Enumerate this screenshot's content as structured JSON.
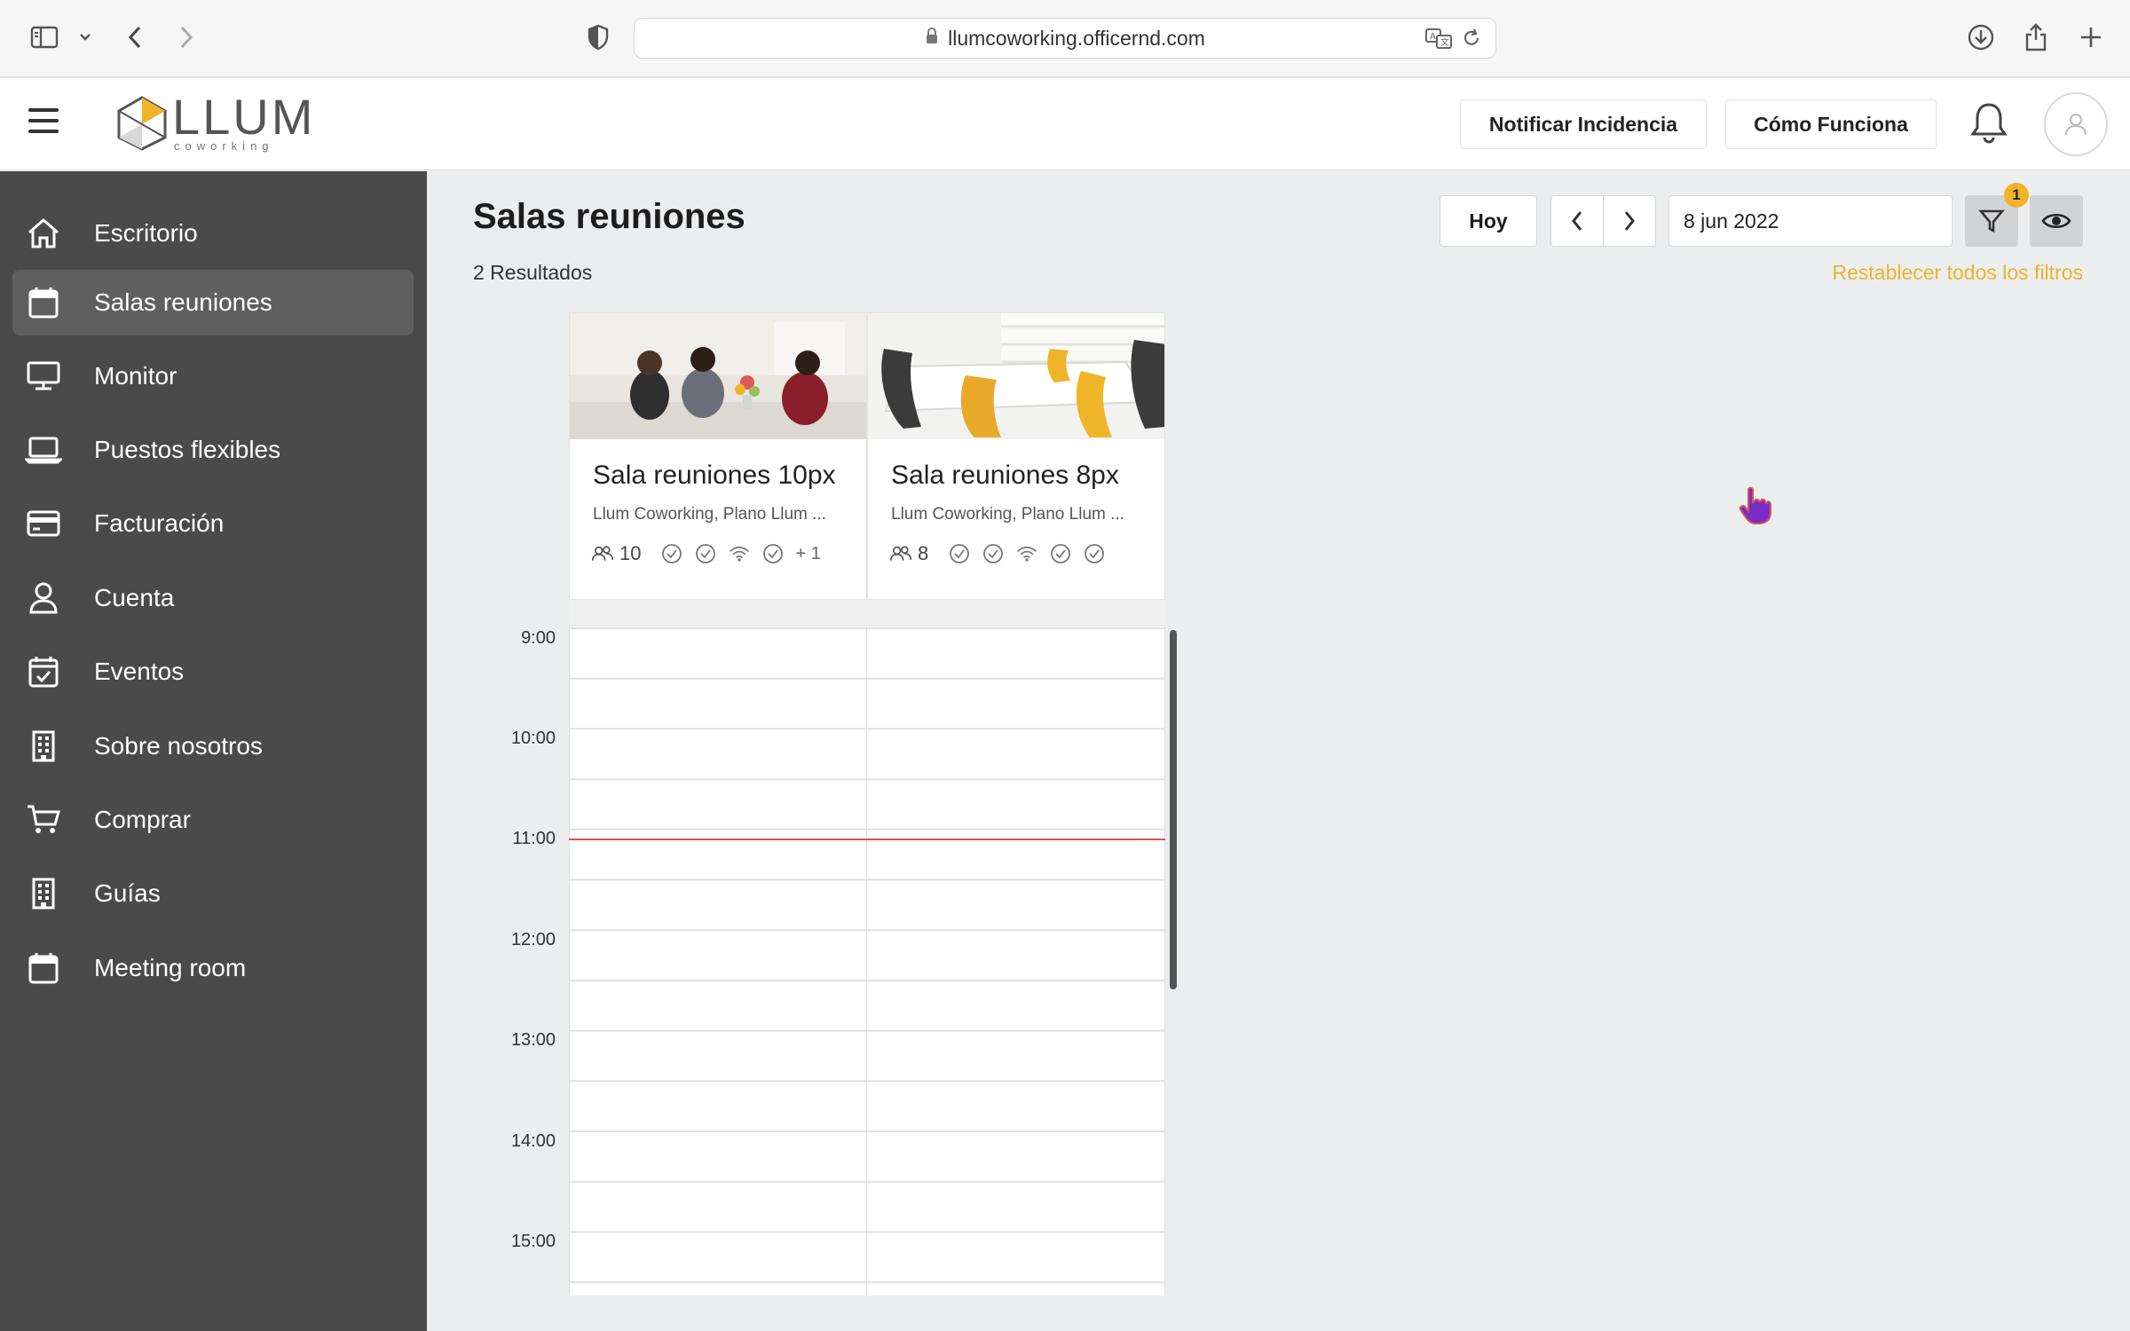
{
  "browser": {
    "url": "llumcoworking.officernd.com"
  },
  "header": {
    "logo_main": "LLUM",
    "logo_sub": "coworking",
    "report_button": "Notificar Incidencia",
    "how_button": "Cómo Funciona"
  },
  "sidebar": {
    "items": [
      {
        "label": "Escritorio",
        "icon": "home-icon"
      },
      {
        "label": "Salas reuniones",
        "icon": "calendar-icon",
        "active": true
      },
      {
        "label": "Monitor",
        "icon": "monitor-icon"
      },
      {
        "label": "Puestos flexibles",
        "icon": "laptop-icon"
      },
      {
        "label": "Facturación",
        "icon": "credit-card-icon"
      },
      {
        "label": "Cuenta",
        "icon": "user-icon"
      },
      {
        "label": "Eventos",
        "icon": "calendar-check-icon"
      },
      {
        "label": "Sobre nosotros",
        "icon": "building-icon"
      },
      {
        "label": "Comprar",
        "icon": "cart-icon"
      },
      {
        "label": "Guías",
        "icon": "building-icon"
      },
      {
        "label": "Meeting room",
        "icon": "calendar-icon"
      }
    ]
  },
  "main": {
    "title": "Salas reuniones",
    "results": "2 Resultados",
    "today_button": "Hoy",
    "date_value": "8 jun 2022",
    "filter_badge": "1",
    "reset_filters": "Restablecer todos los filtros"
  },
  "rooms": [
    {
      "name": "Sala reuniones 10px",
      "location": "Llum Coworking, Plano Llum ...",
      "capacity": "10",
      "more_amenities": "+ 1"
    },
    {
      "name": "Sala reuniones 8px",
      "location": "Llum Coworking, Plano Llum ...",
      "capacity": "8",
      "more_amenities": ""
    }
  ],
  "calendar": {
    "times": [
      "9:00",
      "10:00",
      "11:00",
      "12:00",
      "13:00",
      "14:00",
      "15:00"
    ],
    "now_line_color": "#d9534f"
  },
  "colors": {
    "sidebar_bg": "#4a4a4a",
    "accent": "#e9b52d"
  }
}
